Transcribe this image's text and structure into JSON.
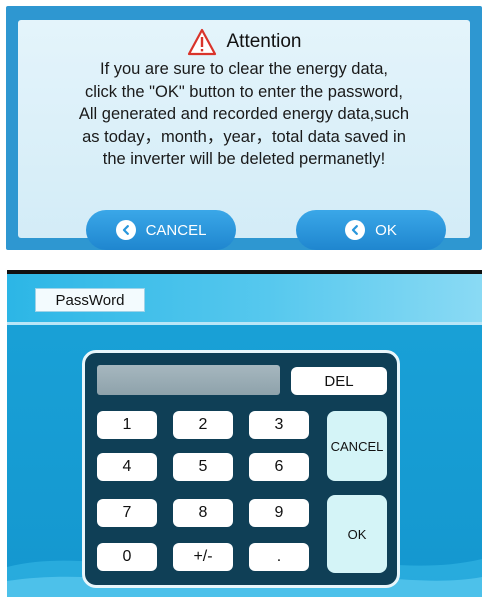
{
  "dialog": {
    "title": "Attention",
    "lines": [
      "If you are sure to clear the energy data,",
      "click the \"OK\" button to enter the password,",
      "All generated and recorded energy data,such",
      "as today，month，year，total data saved in",
      "the inverter will be deleted permanetly!"
    ],
    "cancel_label": "CANCEL",
    "ok_label": "OK",
    "warning_icon": "warning-triangle-icon",
    "button_icon": "back-arrow-icon",
    "colors": {
      "frame": "#2e97d1",
      "panel": "#dcf0f9",
      "button": "#2a97dc",
      "warning": "#d9342b"
    }
  },
  "password_screen": {
    "title": "PassWord",
    "display_value": "",
    "del_label": "DEL",
    "cancel_label": "CANCEL",
    "ok_label": "OK",
    "keys": [
      [
        "1",
        "2",
        "3"
      ],
      [
        "4",
        "5",
        "6"
      ],
      [
        "7",
        "8",
        "9"
      ],
      [
        "0",
        "+/-",
        "."
      ]
    ],
    "colors": {
      "background": "#1aa2d8",
      "keypad": "#0f3f56",
      "side_keys": "#d4f4f7"
    }
  }
}
